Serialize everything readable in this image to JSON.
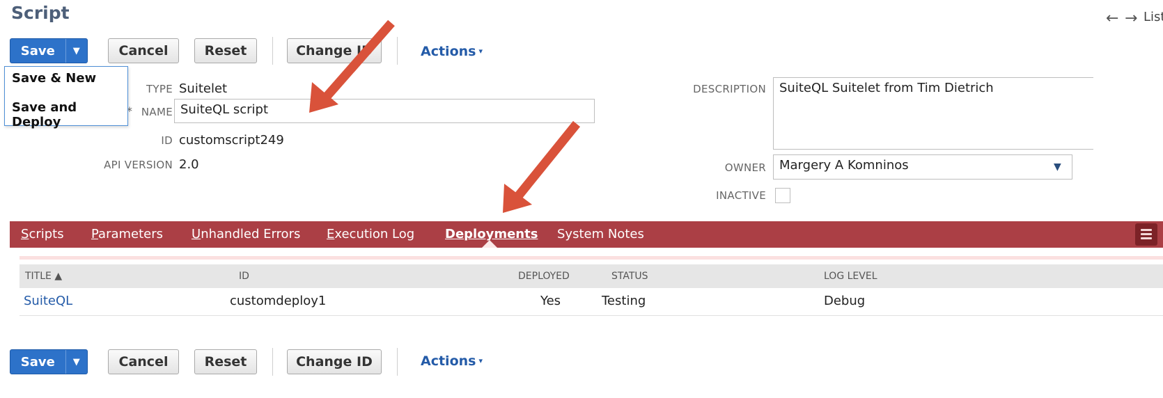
{
  "header": {
    "title": "Script",
    "back_icon": "←",
    "forward_icon": "→",
    "list_label": "List"
  },
  "toolbar": {
    "save_label": "Save",
    "save_caret": "▼",
    "cancel_label": "Cancel",
    "reset_label": "Reset",
    "change_id_label": "Change ID",
    "actions_label": "Actions",
    "actions_caret": "▾"
  },
  "save_menu": {
    "items": [
      "Save & New",
      "Save and Deploy"
    ]
  },
  "form": {
    "type_label": "TYPE",
    "type_value": "Suitelet",
    "name_label": "NAME",
    "name_marker": "*",
    "name_value": "SuiteQL script",
    "id_label": "ID",
    "id_value": "customscript249",
    "api_label": "API VERSION",
    "api_value": "2.0",
    "description_label": "DESCRIPTION",
    "description_value": "SuiteQL Suitelet from Tim Dietrich",
    "owner_label": "OWNER",
    "owner_value": "Margery A Komninos",
    "owner_caret": "▼",
    "inactive_label": "INACTIVE",
    "inactive_checked": false
  },
  "tabs": [
    {
      "label": "Scripts",
      "accel": "S",
      "rest": "cripts",
      "active": false
    },
    {
      "label": "Parameters",
      "accel": "P",
      "rest": "arameters",
      "active": false
    },
    {
      "label": "Unhandled Errors",
      "accel": "U",
      "rest": "nhandled Errors",
      "active": false
    },
    {
      "label": "Execution Log",
      "accel": "E",
      "rest": "xecution Log",
      "active": false
    },
    {
      "label": "Deployments",
      "accel": "D",
      "rest": "eployments",
      "active": true
    },
    {
      "label": "System Notes",
      "accel": "",
      "rest": "System Notes",
      "active": false
    }
  ],
  "table": {
    "headers": {
      "title": "TITLE ▲",
      "id": "ID",
      "deployed": "DEPLOYED",
      "status": "STATUS",
      "log_level": "LOG LEVEL"
    },
    "rows": [
      {
        "title": "SuiteQL",
        "id": "customdeploy1",
        "deployed": "Yes",
        "status": "Testing",
        "log_level": "Debug"
      }
    ]
  },
  "colors": {
    "accent_blue": "#2d72c9",
    "tab_bar": "#ab3f45",
    "annotation_arrow": "#d9523a",
    "title_color": "#4d5f79"
  }
}
